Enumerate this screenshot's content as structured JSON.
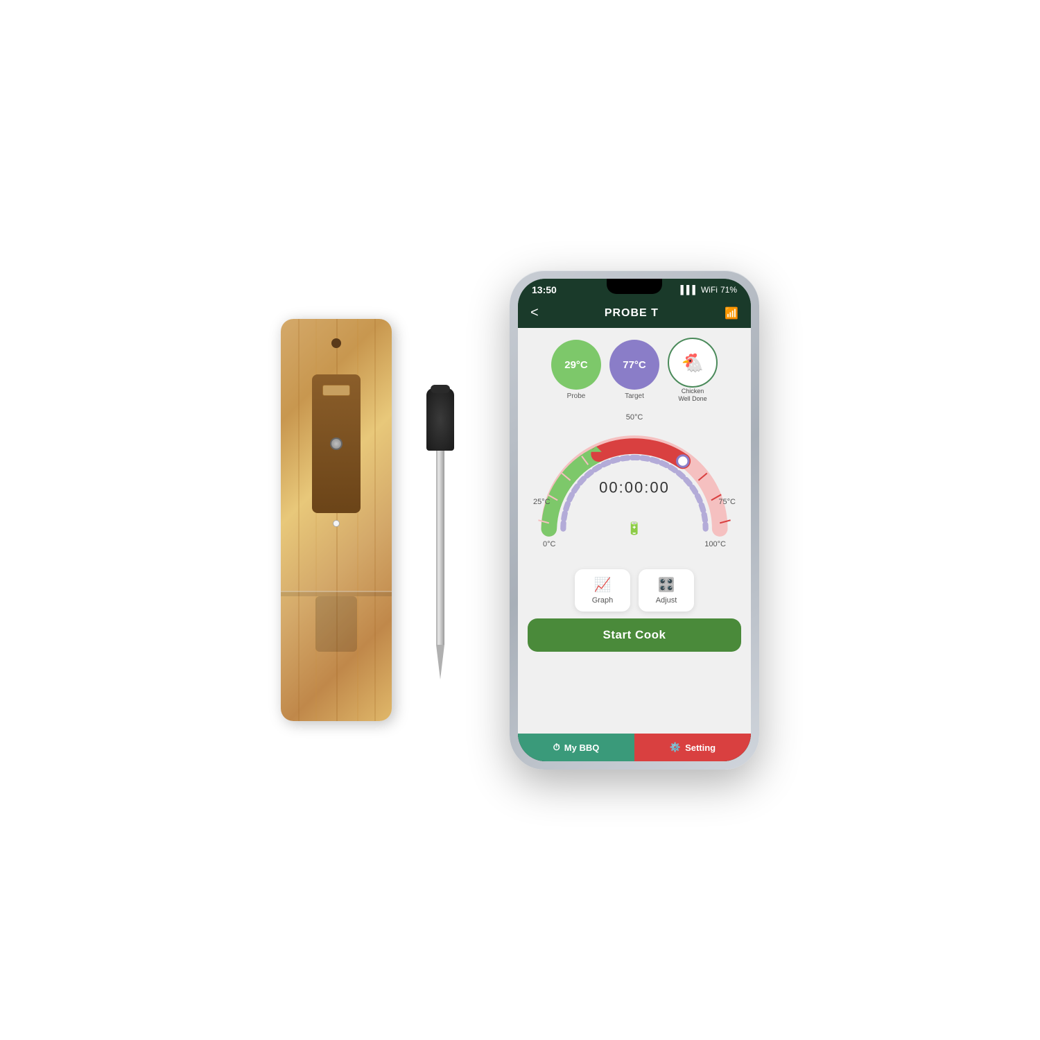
{
  "background": "#ffffff",
  "phone": {
    "status_bar": {
      "time": "13:50",
      "battery": "71"
    },
    "header": {
      "title": "PROBE T",
      "back_label": "<",
      "wifi_label": "wifi"
    },
    "probe_card": {
      "temp": "29°C",
      "label": "Probe"
    },
    "target_card": {
      "temp": "77°C",
      "label": "Target"
    },
    "food_card": {
      "icon": "🐔",
      "label": "Chicken\nWell Done"
    },
    "gauge": {
      "time": "00:00:00",
      "label_0": "0°C",
      "label_25": "25°C",
      "label_50": "50°C",
      "label_75": "75°C",
      "label_100": "100°C"
    },
    "actions": {
      "graph_label": "Graph",
      "adjust_label": "Adjust",
      "start_cook_label": "Start Cook"
    },
    "bottom_nav": {
      "bbq_label": "My BBQ",
      "setting_label": "Setting"
    }
  }
}
